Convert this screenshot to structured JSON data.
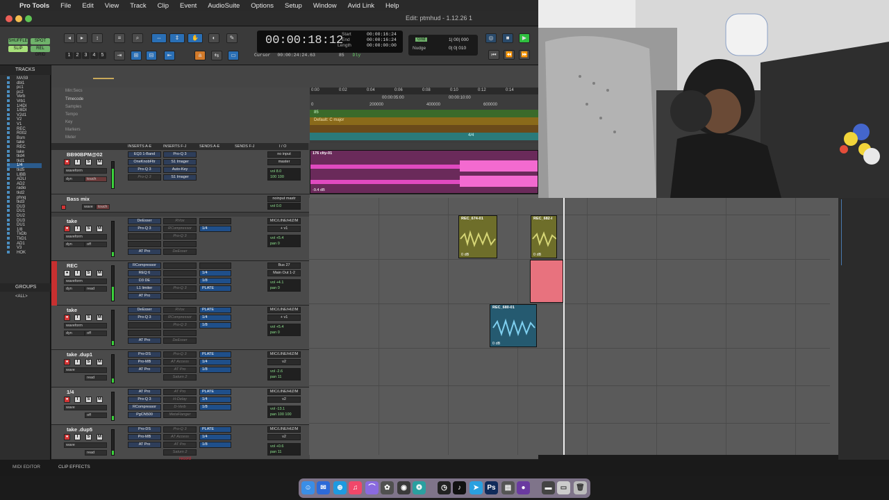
{
  "menubar": {
    "apple": "",
    "app": "Pro Tools",
    "items": [
      "File",
      "Edit",
      "View",
      "Track",
      "Clip",
      "Event",
      "AudioSuite",
      "Options",
      "Setup",
      "Window",
      "Avid Link",
      "Help"
    ]
  },
  "window": {
    "title": "Edit: ptmhud - 1.12.26 1"
  },
  "toolbar": {
    "modes": [
      "SHUFFLE",
      "SPOT",
      "SLIP",
      "REL GRID"
    ],
    "nums": [
      "1",
      "2",
      "3",
      "4",
      "5"
    ],
    "main_counter": "00:00:18:12",
    "start_label": "Start",
    "end_label": "End",
    "length_label": "Length",
    "start": "00:00:16:24",
    "end": "00:00:16:24",
    "length": "00:00:00:00",
    "cursor_label": "Cursor",
    "cursor": "00:00:24:24.63",
    "tempo": "85",
    "dly": "Dly",
    "grid_label": "Grid",
    "grid_value": "1| 00| 000",
    "nudge_label": "Nudge",
    "nudge_value": "0| 0| 010"
  },
  "tracks_panel": {
    "header": "TRACKS",
    "groups_header": "GROUPS",
    "group_all": "<ALL>",
    "items": [
      "MAS9",
      "dbl1",
      "pc1",
      "pc2",
      "Verb",
      "Vrb1",
      "1/4DI",
      "1/8DI",
      "V2d1",
      "V2",
      "V1",
      "REC",
      "R002",
      "Bsm",
      "take",
      "REC",
      "lake",
      "tkd4",
      "tkd1",
      "1/4",
      "tkd5",
      "LIBB",
      "ADLI",
      "AD2",
      "radio",
      "tkd2",
      "phnq",
      "tkd3",
      "DU3",
      "DU1",
      "DU2",
      "DU3",
      "DU1",
      "1/8",
      "TkDb",
      "TkD1",
      "AD1",
      "V3",
      "HOK"
    ]
  },
  "rulers": {
    "labels": [
      "Min:Secs",
      "Timecode",
      "Samples",
      "Tempo",
      "Key",
      "Markers",
      "Meter"
    ],
    "mins": [
      "0:00",
      "0:02",
      "0:04",
      "0:06",
      "0:08",
      "0:10",
      "0:12",
      "0:14"
    ],
    "timecode": [
      "00:00:05:00",
      "00:00:10:00"
    ],
    "samples": [
      "0",
      "200000",
      "400000",
      "600000"
    ],
    "key": "Default: C major",
    "meter": "4/4",
    "tempo_marker": "85"
  },
  "columns": {
    "inserts_ae": "INSERTS A-E",
    "inserts_fj": "INSERTS F-J",
    "sends_ae": "SENDS A-E",
    "sends_fj": "SENDS F-J",
    "io": "I / O"
  },
  "tracks": [
    {
      "name": "BB90BPM@02",
      "view": "waveform",
      "mode": "dyn",
      "auto": "touch",
      "inserts": [
        "EQ3 1-Band",
        "OneKnobFltr",
        "Pro-Q 3",
        "Pro-Q 3"
      ],
      "inserts2": [
        "Pro-Q 3",
        "S1 Imager",
        "Auto-Key",
        "S1 Imager"
      ],
      "sends": [],
      "io": [
        "no input",
        "master"
      ],
      "vol": "8.0",
      "pan": "100  100",
      "clip": "176 clty-01",
      "gain": "-9.4 dB"
    },
    {
      "name": "Bass mix",
      "view": "wave",
      "auto": "touch",
      "io": [
        "noinput  mastr"
      ],
      "vol": "0.0"
    },
    {
      "name": "take",
      "view": "waveform",
      "mode": "dyn",
      "auto": "off",
      "inserts": [
        "DeEsser",
        "Pro-Q 3",
        "",
        "",
        "AT Pro"
      ],
      "inserts2": [
        "RVox",
        "RCompressor",
        "Pro-Q 3",
        "",
        "DeEsser"
      ],
      "sends": [
        "",
        "1/4"
      ],
      "io": [
        "MIC/LINE/HIZ/M",
        "+ v1"
      ],
      "vol": "+5.4",
      "pan": "0"
    },
    {
      "name": "REC",
      "view": "waveform",
      "mode": "dyn",
      "auto": "read",
      "inserts": [
        "RCompressor",
        "REQ 6",
        "D3 DE",
        "L1 limiter",
        "AT Pro"
      ],
      "inserts2": [
        "",
        "",
        "",
        "Pro-Q 3",
        ""
      ],
      "sends": [
        "",
        "1/4",
        "1/8",
        "PLATE"
      ],
      "io": [
        "Bus 27",
        "Main Out 1-2"
      ],
      "vol": "+4.1",
      "pan": "0"
    },
    {
      "name": "take",
      "view": "waveform",
      "mode": "dyn",
      "auto": "off",
      "inserts": [
        "DeEsser",
        "Pro-Q 3",
        "",
        "",
        "AT Pro"
      ],
      "inserts2": [
        "RVox",
        "RCompressor",
        "Pro-Q 3",
        "",
        "DeEsser"
      ],
      "sends": [
        "PLATE",
        "1/4",
        "1/8"
      ],
      "io": [
        "MIC/LINE/HIZ/M",
        "+ v1"
      ],
      "vol": "+5.4",
      "pan": "0"
    },
    {
      "name": "take .dup1",
      "view": "wave",
      "auto": "read",
      "inserts": [
        "Pro-DS",
        "Pro-MB",
        "AT Pro"
      ],
      "inserts2": [
        "Pro-Q 3",
        "AT Access",
        "AT Pro",
        "Saturn 2"
      ],
      "sends": [
        "PLATE",
        "1/4",
        "1/8"
      ],
      "io": [
        "MIC/LINE/HIZ/M",
        "v2"
      ],
      "vol": "-2.6",
      "pan": "11"
    },
    {
      "name": "1/4",
      "view": "wave",
      "auto": "off",
      "inserts": [
        "AT Pro",
        "Pro-Q 3",
        "RCompressor",
        "PgCN500"
      ],
      "inserts2": [
        "AT Pro",
        "H-Delay",
        "D-Verb",
        "MetaFlanger"
      ],
      "sends": [
        "PLATE",
        "1/4",
        "1/8"
      ],
      "io": [
        "MIC/LINE/HIZ/M",
        "v2"
      ],
      "vol": "-13.1",
      "pan": "100  100"
    },
    {
      "name": "take .dup5",
      "view": "wave",
      "auto": "read",
      "inserts": [
        "Pro-DS",
        "Pro-MB",
        "AT Pro"
      ],
      "inserts2": [
        "Pro-Q 3",
        "AT Access",
        "AT Pro",
        "Saturn 2"
      ],
      "sends": [
        "PLATE",
        "1/4",
        "1/8"
      ],
      "io": [
        "MIC/LINE/HIZ/M",
        "v2"
      ],
      "vol": "+0.6",
      "pan": "11"
    }
  ],
  "clips": [
    {
      "name": "REC_674-01",
      "gain": "0 dB"
    },
    {
      "name": "REC_682-I",
      "gain": "0 dB"
    },
    {
      "name": "REC_680-01",
      "gain": "0 dB"
    }
  ],
  "bottom": {
    "midi_editor": "MIDI EDITOR",
    "clip_effects": "CLIP EFFECTS",
    "record": "record"
  },
  "colors": {
    "accent": "#2a6fb5",
    "waveform_pink": "#c83aa8",
    "clip_olive": "#7a7a2a",
    "clip_blue": "#2a6a8a",
    "clip_red": "#e86a7a"
  }
}
